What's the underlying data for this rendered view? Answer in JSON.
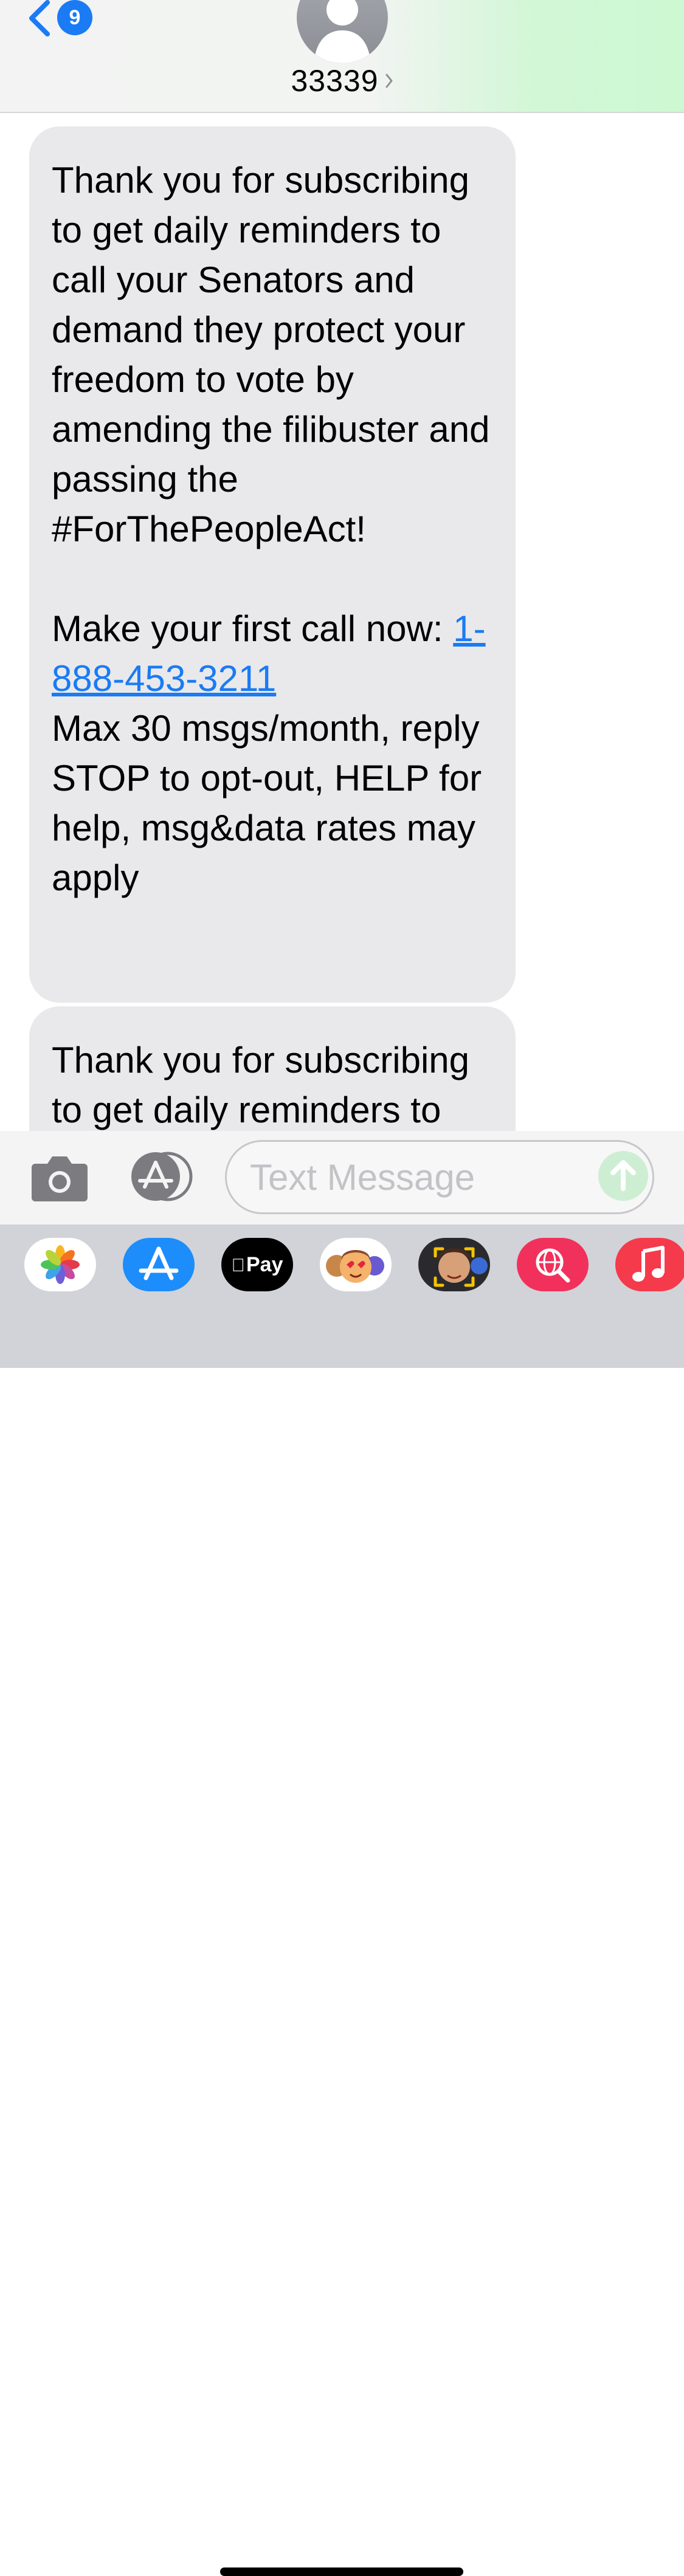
{
  "header": {
    "back_badge_count": "9",
    "contact_name": "33339"
  },
  "messages": [
    {
      "text_before_link": "Thank you for subscribing to get daily reminders to call your Senators and demand they protect your freedom to vote by amending the filibuster and passing the #ForThePeopleAct!\n\nMake your first call now: ",
      "link_text": "1-888-453-3211",
      "text_after_link": "\nMax 30 msgs/month, reply STOP to opt-out, HELP for help, msg&data rates may apply"
    },
    {
      "text": "Thank you for subscribing to get daily reminders to call your"
    }
  ],
  "compose": {
    "placeholder": "Text Message",
    "value": ""
  },
  "app_drawer": {
    "apple_pay_label": "Pay",
    "apps": [
      "photos-app",
      "app-store-app",
      "apple-pay-app",
      "memoji-stickers-app",
      "memoji-app",
      "image-search-app",
      "music-app"
    ]
  },
  "colors": {
    "accent_blue": "#1a7bf5",
    "incoming_bubble": "#e9e9eb",
    "header_green_tint": "#cdf8d2",
    "send_button": "#cdeed2",
    "drawer_background": "#d1d3d9"
  }
}
